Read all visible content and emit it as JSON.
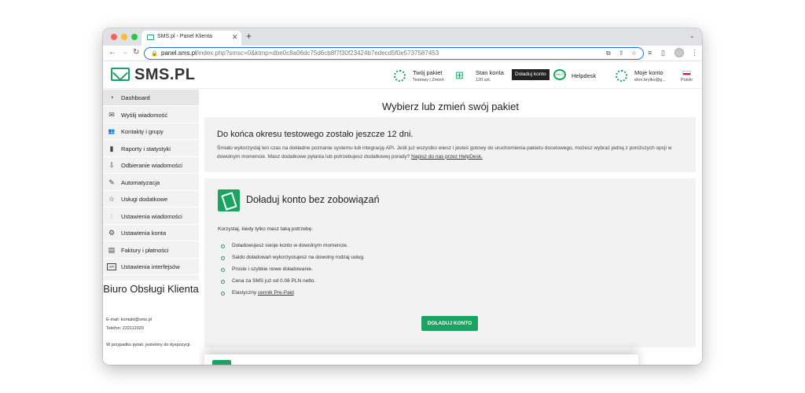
{
  "browser": {
    "tab_title": "SMS.pl - Panel Klienta",
    "url_host": "panel.sms.pl",
    "url_path": "/index.php?smsc=0&ktmp=dbe0c8a06dc75d6cb8f7f30f23424b7edecd5f0e5737587453"
  },
  "header": {
    "logo": "SMS.PL",
    "package": {
      "label": "Twój pakiet",
      "sub": "Testowy | Zmień"
    },
    "balance": {
      "label": "Stan konta",
      "sub": "120 szt."
    },
    "topup_button": "Doładuj konto",
    "help_bubble": "HELP",
    "helpdesk": "Helpdesk",
    "account": {
      "label": "Moje konto",
      "sub": "elon.brylko@g..."
    },
    "language": "Polski"
  },
  "sidebar": {
    "items": [
      {
        "label": "Dashboard",
        "icon": "gauge-icon",
        "glyph": "◔"
      },
      {
        "label": "Wyślij wiadomość",
        "icon": "envelope-icon",
        "glyph": "✉"
      },
      {
        "label": "Kontakty i grupy",
        "icon": "contacts-icon",
        "glyph": "👥"
      },
      {
        "label": "Raporty i statystyki",
        "icon": "bar-chart-icon",
        "glyph": "▮"
      },
      {
        "label": "Odbieranie wiadomości",
        "icon": "download-icon",
        "glyph": "⇩"
      },
      {
        "label": "Automatyzacja",
        "icon": "pen-icon",
        "glyph": "✎"
      },
      {
        "label": "Usługi dodatkowe",
        "icon": "star-icon",
        "glyph": "☆"
      },
      {
        "label": "Ustawienia wiadomości",
        "icon": "sliders-icon",
        "glyph": "⫶"
      },
      {
        "label": "Ustawienia konta",
        "icon": "gear-icon",
        "glyph": "⚙"
      },
      {
        "label": "Faktury i płatności",
        "icon": "invoice-icon",
        "glyph": "▤"
      },
      {
        "label": "Ustawienia interfejsów",
        "icon": "api-icon",
        "glyph": "API"
      }
    ],
    "bok": {
      "title": "Biuro Obsługi Klienta",
      "email": "E-mail: kontakt@sms.pl",
      "phone": "Telefon: 222112020",
      "note": "W przypadku pytań, jesteśmy do dyspozycji."
    }
  },
  "main": {
    "title": "Wybierz lub zmień swój pakiet",
    "trial_title": "Do końca okresu testowego zostało jeszcze 12 dni.",
    "trial_text": "Śmiało wykorzystaj ten czas na dokładne poznanie systemu lub integrację API. Jeśli już wszystko wiesz i jesteś gotowy do uruchomienia pakietu docelowego, możesz wybrać jedną z poniższych opcji w dowolnym momencie. Masz dodatkowe pytania lub potrzebujesz dodatkowej porady?",
    "trial_link": "Napisz do nas przez HelpDesk.",
    "card_title": "Doładuj konto bez zobowiązań",
    "card_lead": "Korzystaj, kiedy tylko masz taką potrzebę.",
    "bullets": [
      "Doładowujesz swoje konto w dowolnym momencie.",
      "Saldo doładowań wykorzystujesz na dowolny rodzaj usług.",
      "Proste i szybkie nowe doładowanie.",
      "Cena za SMS już od 0.06 PLN netto."
    ],
    "bullet_last_prefix": "Elastyczny",
    "bullet_last_link": "cennik Pre-Paid",
    "cta": "DOŁADUJ KONTO"
  },
  "colors": {
    "brand_green": "#1ba361",
    "panel_bg": "#f2f2f2"
  }
}
